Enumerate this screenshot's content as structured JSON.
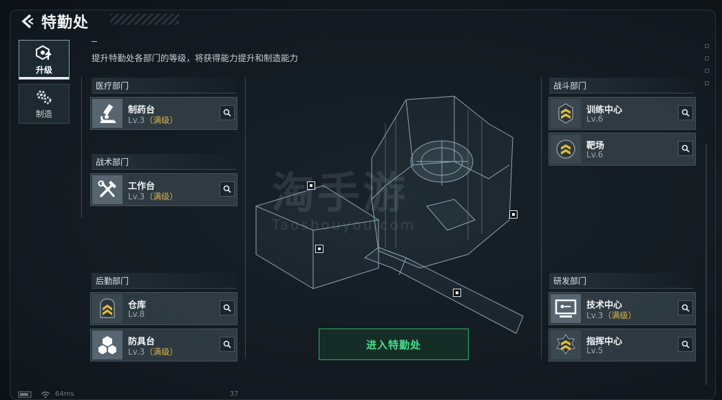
{
  "header": {
    "title": "特勤处"
  },
  "tabs": [
    {
      "label": "升级",
      "icon": "upgrade-icon",
      "active": true
    },
    {
      "label": "制造",
      "icon": "gears-icon",
      "active": false
    }
  ],
  "description": "提升特勤处各部门的等级，将获得能力提升和制造能力",
  "departments": {
    "medical": {
      "name": "医疗部门",
      "items": [
        {
          "name": "制药台",
          "level": "Lv.3",
          "max": "（满级）",
          "icon": "microscope-icon"
        }
      ]
    },
    "tactical": {
      "name": "战术部门",
      "items": [
        {
          "name": "工作台",
          "level": "Lv.3",
          "max": "（满级）",
          "icon": "tools-icon"
        }
      ]
    },
    "logistics": {
      "name": "后勤部门",
      "items": [
        {
          "name": "仓库",
          "level": "Lv.8",
          "max": "",
          "icon": "chevron-rank-icon"
        },
        {
          "name": "防具台",
          "level": "Lv.3",
          "max": "（满级）",
          "icon": "cubes-icon"
        }
      ]
    },
    "combat": {
      "name": "战斗部门",
      "items": [
        {
          "name": "训练中心",
          "level": "Lv.6",
          "max": "",
          "icon": "rank-wings-icon"
        },
        {
          "name": "靶场",
          "level": "Lv.6",
          "max": "",
          "icon": "rank-circle-icon"
        }
      ]
    },
    "research": {
      "name": "研发部门",
      "items": [
        {
          "name": "技术中心",
          "level": "Lv.3",
          "max": "（满级）",
          "icon": "monitor-icon"
        },
        {
          "name": "指挥中心",
          "level": "Lv.5",
          "max": "",
          "icon": "rank-star-icon"
        }
      ]
    }
  },
  "enter_button": "进入特勤处",
  "status": {
    "ping": "64ms",
    "counter": "37"
  },
  "watermark": {
    "logo": "淘手游",
    "url": "Taoshouyou.com"
  },
  "colors": {
    "accent_green": "#45e08a",
    "max_gold": "#d9b24a",
    "rank_gold": "#e2b93a"
  }
}
